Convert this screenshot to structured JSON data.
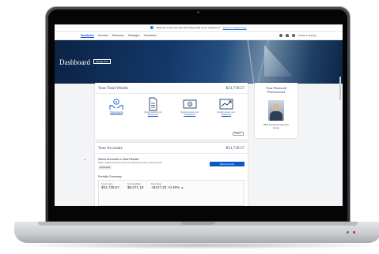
{
  "banner": {
    "message": "Welcome to the new site! Not finding what you're looking for?",
    "link": "Switch to Classic View"
  },
  "nav": {
    "items": [
      "Dashboard",
      "Accounts",
      "Resources",
      "Messages",
      "Documents"
    ],
    "user": "Profile & Settings"
  },
  "hero": {
    "title": "Dashboard",
    "manage_button": "Manage View"
  },
  "wealth": {
    "title": "Your Total Wealth",
    "amount": "$31,739.57",
    "tiles": [
      {
        "icon": "money-hands-icon",
        "line1": "Total accounts",
        "line2": "$31,739.57",
        "link_first": true
      },
      {
        "icon": "document-icon",
        "line1": "Quickly access your",
        "line2": "Documents",
        "link_first": false
      },
      {
        "icon": "cash-icon",
        "line1": "Quickly access your",
        "line2": "Transactions",
        "link_first": false
      },
      {
        "icon": "chart-trend-icon",
        "line1": "Quickly access your",
        "line2": "Resources",
        "link_first": false
      }
    ],
    "more": "Detail"
  },
  "advisor": {
    "title_line1": "Your Financial",
    "title_line2": "Professional",
    "name_line1": "RBC Investment Services",
    "name_line2": "Group"
  },
  "accounts": {
    "title": "Your Accounts",
    "amount": "$31,739.57",
    "subtitle": "Select Accounts to View Results",
    "description": "Select multiple accounts to see your details and create custom groups",
    "chip": "All Accounts",
    "select_button": "Select Accounts",
    "summary_title": "Portfolio Summary",
    "summary": {
      "labels": [
        "Current value",
        "Funds available",
        "Day change"
      ],
      "values": [
        "$31,739.57",
        "$6,071.19",
        "+$127.33 +0.40%"
      ]
    }
  },
  "colors": {
    "brand_blue": "#0a58ca",
    "navy_text": "#1c3f66",
    "hero_dark": "#0b2344",
    "positive": "#1c8a3a"
  }
}
